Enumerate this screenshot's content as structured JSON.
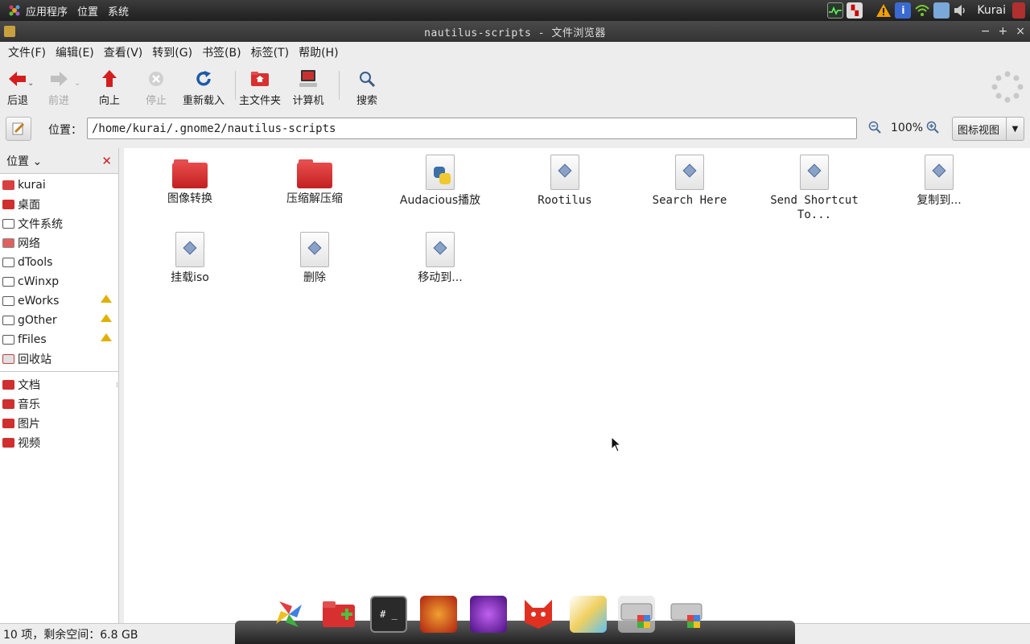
{
  "top_panel": {
    "menus": [
      "应用程序",
      "位置",
      "系统"
    ],
    "user": "Kurai"
  },
  "window": {
    "title": "nautilus-scripts - 文件浏览器",
    "controls": [
      "−",
      "+",
      "×"
    ]
  },
  "menubar": [
    "文件(F)",
    "编辑(E)",
    "查看(V)",
    "转到(G)",
    "书签(B)",
    "标签(T)",
    "帮助(H)"
  ],
  "toolbar": {
    "back": "后退",
    "forward": "前进",
    "up": "向上",
    "stop": "停止",
    "reload": "重新载入",
    "home": "主文件夹",
    "computer": "计算机",
    "search": "搜索"
  },
  "location": {
    "label": "位置：",
    "path": "/home/kurai/.gnome2/nautilus-scripts",
    "zoom": "100%",
    "view_mode": "图标视图"
  },
  "sidebar": {
    "header": "位置",
    "places": [
      {
        "label": "kurai",
        "icon": "home-icon",
        "eject": false
      },
      {
        "label": "桌面",
        "icon": "desktop-icon",
        "eject": false
      },
      {
        "label": "文件系统",
        "icon": "drive-icon",
        "eject": false
      },
      {
        "label": "网络",
        "icon": "network-icon",
        "eject": false
      },
      {
        "label": "dTools",
        "icon": "drive-icon",
        "eject": false
      },
      {
        "label": "cWinxp",
        "icon": "drive-icon",
        "eject": false
      },
      {
        "label": "eWorks",
        "icon": "drive-icon",
        "eject": true
      },
      {
        "label": "gOther",
        "icon": "drive-icon",
        "eject": true
      },
      {
        "label": "fFiles",
        "icon": "drive-icon",
        "eject": true
      },
      {
        "label": "回收站",
        "icon": "trash-icon",
        "eject": false
      }
    ],
    "bookmarks": [
      {
        "label": "文档",
        "icon": "folder-icon"
      },
      {
        "label": "音乐",
        "icon": "folder-icon"
      },
      {
        "label": "图片",
        "icon": "folder-icon"
      },
      {
        "label": "视频",
        "icon": "folder-icon"
      }
    ]
  },
  "files": [
    {
      "name": "图像转换",
      "type": "folder"
    },
    {
      "name": "压缩解压缩",
      "type": "folder"
    },
    {
      "name": "Audacious播放",
      "type": "python-script"
    },
    {
      "name": "Rootilus",
      "type": "script"
    },
    {
      "name": "Search Here",
      "type": "script"
    },
    {
      "name": "Send Shortcut To...",
      "type": "script"
    },
    {
      "name": "复制到...",
      "type": "script"
    },
    {
      "name": "挂载iso",
      "type": "script"
    },
    {
      "name": "删除",
      "type": "script"
    },
    {
      "name": "移动到...",
      "type": "script"
    }
  ],
  "status": "10 项，剩余空间：6.8 GB",
  "dock": {
    "apps": [
      "pinwheel-app-icon",
      "add-folder-app-icon",
      "terminal-app-icon",
      "browser-app-icon",
      "purple-orb-app-icon",
      "cat-app-icon",
      "photo-app-icon",
      "drive-app-icon",
      "drive-app-icon-2"
    ],
    "terminal_glyph": "# _"
  }
}
